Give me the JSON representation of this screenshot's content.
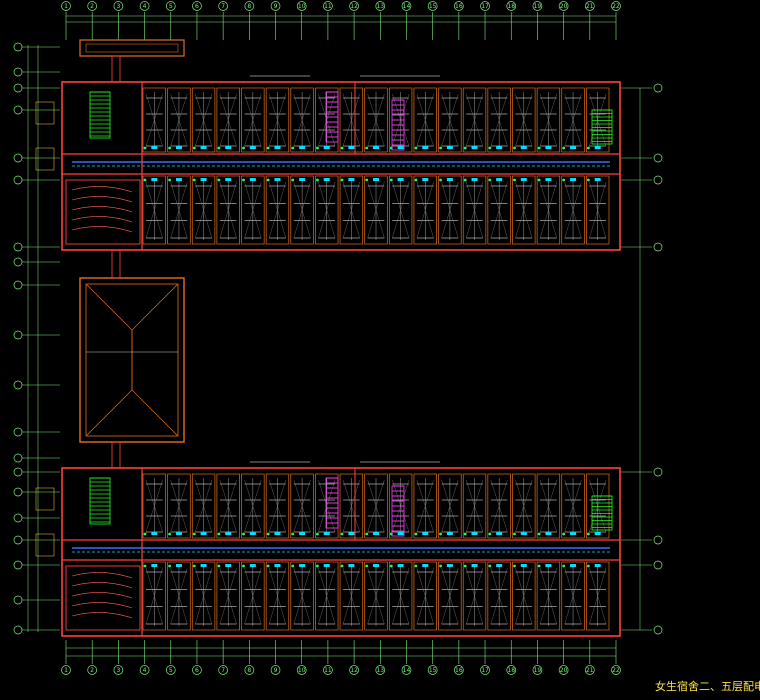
{
  "drawing": {
    "title": "女生宿舍二、五层配电照明平面图",
    "colors": {
      "background": "#000000",
      "grid_axis": "#7cf07c",
      "wall": "#ff4040",
      "wall_alt": "#e07020",
      "fixture": "#ffffff",
      "circuit": "#00e0ff",
      "feeder": "#3a6bff",
      "stair": "#20ff20",
      "riser": "#ff40ff",
      "dim": "#9fd6ff",
      "title": "#ffe24a"
    },
    "axes_top": [
      "1",
      "2",
      "3",
      "4",
      "5",
      "6",
      "7",
      "8",
      "9",
      "10",
      "11",
      "12",
      "13",
      "14",
      "15",
      "16",
      "17",
      "18",
      "19",
      "20",
      "21",
      "22"
    ],
    "axes_left": [
      "A",
      "B",
      "C",
      "D",
      "E",
      "F",
      "G",
      "H",
      "J",
      "K",
      "L",
      "M",
      "N",
      "P",
      "Q",
      "R",
      "S",
      "T",
      "U",
      "V",
      "W"
    ],
    "axes_right": [
      "A",
      "B",
      "C",
      "D",
      "E",
      "F",
      "G",
      "H"
    ],
    "wing_count": 2,
    "room_bays_per_row": 19
  }
}
